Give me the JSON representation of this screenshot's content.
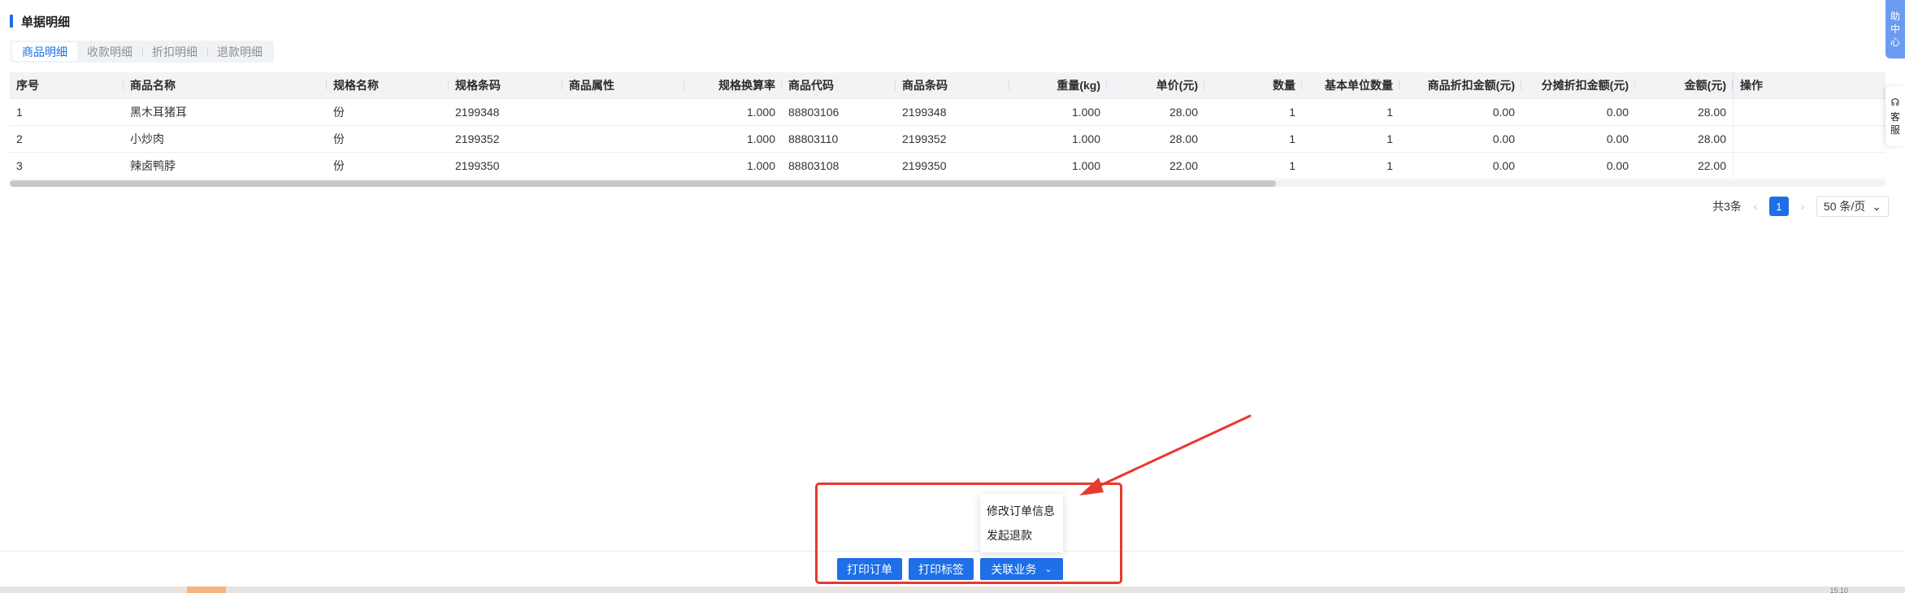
{
  "section_title": "单据明细",
  "tabs": [
    {
      "label": "商品明细",
      "active": true
    },
    {
      "label": "收款明细",
      "active": false
    },
    {
      "label": "折扣明细",
      "active": false
    },
    {
      "label": "退款明细",
      "active": false
    }
  ],
  "table": {
    "headers": [
      "序号",
      "商品名称",
      "规格名称",
      "规格条码",
      "商品属性",
      "规格换算率",
      "商品代码",
      "商品条码",
      "重量(kg)",
      "单价(元)",
      "数量",
      "基本单位数量",
      "商品折扣金额(元)",
      "分摊折扣金额(元)",
      "金额(元)",
      "操作"
    ],
    "rows": [
      [
        "1",
        "黑木耳猪耳",
        "份",
        "2199348",
        "",
        "1.000",
        "88803106",
        "2199348",
        "1.000",
        "28.00",
        "1",
        "1",
        "0.00",
        "0.00",
        "28.00",
        ""
      ],
      [
        "2",
        "小炒肉",
        "份",
        "2199352",
        "",
        "1.000",
        "88803110",
        "2199352",
        "1.000",
        "28.00",
        "1",
        "1",
        "0.00",
        "0.00",
        "28.00",
        ""
      ],
      [
        "3",
        "辣卤鸭脖",
        "份",
        "2199350",
        "",
        "1.000",
        "88803108",
        "2199350",
        "1.000",
        "22.00",
        "1",
        "1",
        "0.00",
        "0.00",
        "22.00",
        ""
      ]
    ]
  },
  "pagination": {
    "total": "共3条",
    "prev": "‹",
    "current": "1",
    "next": "›",
    "page_size": "50 条/页",
    "page_size_arrow": "⌄"
  },
  "buttons": {
    "print_order": "打印订单",
    "print_label": "打印标签",
    "related_business": "关联业务",
    "chevron": "⌄"
  },
  "dropdown": {
    "items": [
      "修改订单信息",
      "发起退款"
    ]
  },
  "side": {
    "help_chars": [
      "助",
      "中",
      "心"
    ],
    "help_top": "助",
    "service_chars": [
      "客",
      "服"
    ],
    "headset_icon": "☊"
  },
  "colors": {
    "accent": "#1e6fe8",
    "highlight": "#e8392f"
  },
  "corner_time": "15:10"
}
